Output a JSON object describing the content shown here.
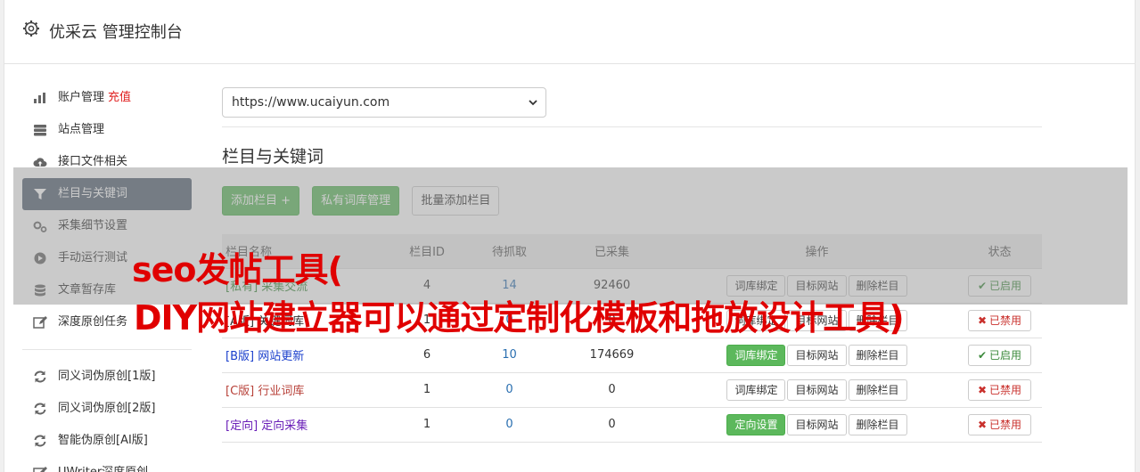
{
  "header": {
    "title": "优采云 管理控制台"
  },
  "sidebar": {
    "group1": [
      {
        "label": "账户管理",
        "extra": "充值",
        "icon": "bar-chart-icon"
      },
      {
        "label": "站点管理",
        "icon": "server-icon"
      },
      {
        "label": "接口文件相关",
        "icon": "cloud-upload-icon"
      },
      {
        "label": "栏目与关键词",
        "icon": "filter-icon",
        "active": true
      },
      {
        "label": "采集细节设置",
        "icon": "gears-icon"
      },
      {
        "label": "手动运行测试",
        "icon": "play-circle-icon"
      },
      {
        "label": "文章暂存库",
        "icon": "database-icon"
      },
      {
        "label": "深度原创任务",
        "icon": "edit-icon"
      }
    ],
    "group2": [
      {
        "label": "同义词伪原创[1版]",
        "icon": "refresh-icon"
      },
      {
        "label": "同义词伪原创[2版]",
        "icon": "refresh-icon"
      },
      {
        "label": "智能伪原创[AI版]",
        "icon": "refresh-icon"
      },
      {
        "label": "UWriter深度原创",
        "icon": "edit-icon"
      }
    ]
  },
  "main": {
    "site_select": "https://www.ucaiyun.com",
    "section_title": "栏目与关键词",
    "buttons": {
      "add_column": "添加栏目 +",
      "private_lexicon": "私有词库管理",
      "batch_add": "批量添加栏目"
    },
    "table": {
      "headers": [
        "栏目名称",
        "栏目ID",
        "待抓取",
        "已采集",
        "操作",
        "状态"
      ],
      "rows": [
        {
          "tag": "[私有]",
          "name": "采集交流",
          "id": "4",
          "pending": "14",
          "collected": "92460",
          "op1": "词库绑定",
          "op1_green": false,
          "op2": "目标网站",
          "op3": "删除栏目",
          "status": "已启用",
          "status_on": true,
          "color": "#3c8a3c"
        },
        {
          "tag": "[A版]",
          "name": "关键词库",
          "id": "1",
          "pending": "0",
          "collected": "0",
          "op1": "词库绑定",
          "op1_green": false,
          "op2": "目标网站",
          "op3": "删除栏目",
          "status": "已禁用",
          "status_on": false,
          "color": "#333333"
        },
        {
          "tag": "[B版]",
          "name": "网站更新",
          "id": "6",
          "pending": "10",
          "collected": "174669",
          "op1": "词库绑定",
          "op1_green": true,
          "op2": "目标网站",
          "op3": "删除栏目",
          "status": "已启用",
          "status_on": true,
          "color": "#1a3fcc"
        },
        {
          "tag": "[C版]",
          "name": "行业词库",
          "id": "1",
          "pending": "0",
          "collected": "0",
          "op1": "词库绑定",
          "op1_green": false,
          "op2": "目标网站",
          "op3": "删除栏目",
          "status": "已禁用",
          "status_on": false,
          "color": "#b8423a"
        },
        {
          "tag": "[定向]",
          "name": "定向采集",
          "id": "1",
          "pending": "0",
          "collected": "0",
          "op1": "定向设置",
          "op1_green": true,
          "op2": "目标网站",
          "op3": "删除栏目",
          "status": "已禁用",
          "status_on": false,
          "color": "#6a1fb8"
        }
      ]
    }
  },
  "overlay": {
    "line1": "seo发帖工具(",
    "line2": "DIY网站建立器可以通过定制化模板和拖放设计工具)"
  },
  "colors": {
    "active_sidebar": "#556372",
    "green": "#5cb85c",
    "overlay_text": "#e00000"
  }
}
